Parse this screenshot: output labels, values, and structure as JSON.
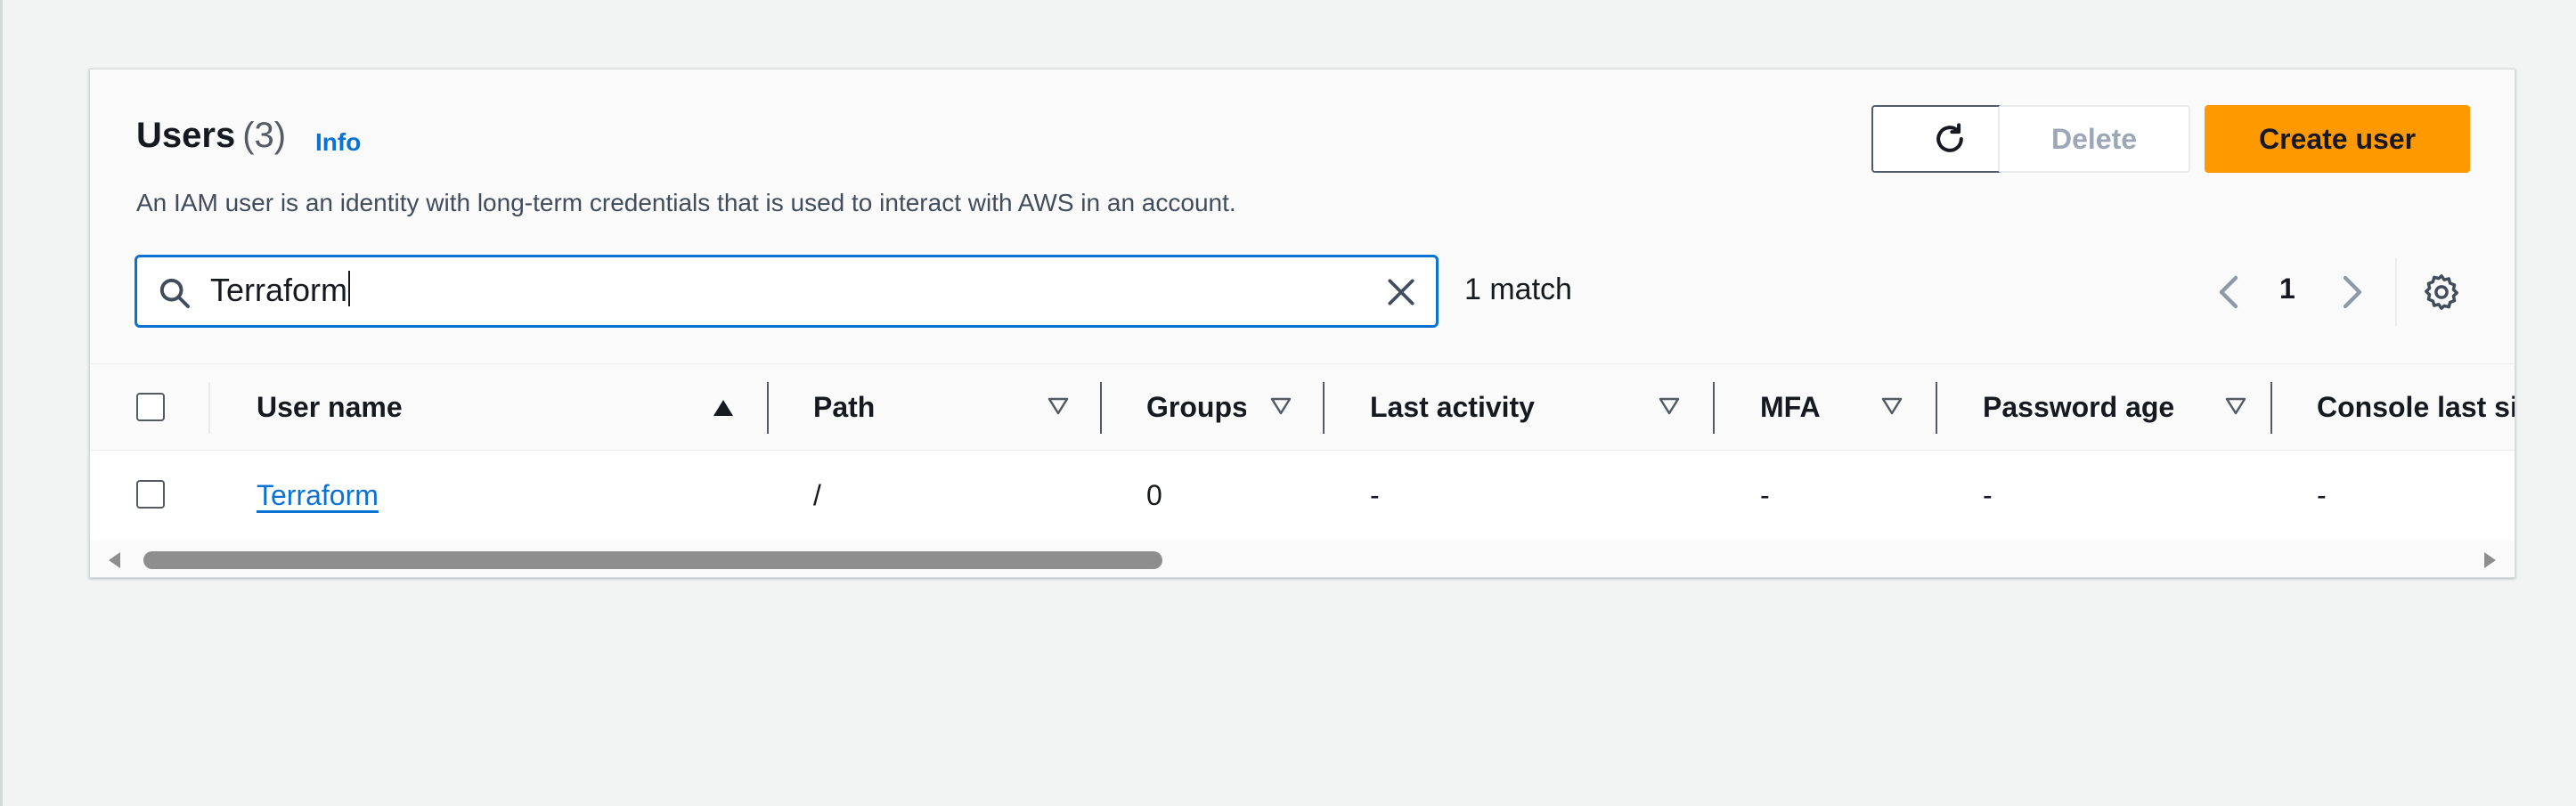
{
  "header": {
    "title": "Users",
    "count": "(3)",
    "info": "Info",
    "description": "An IAM user is an identity with long-term credentials that is used to interact with AWS in an account."
  },
  "actions": {
    "delete_label": "Delete",
    "create_label": "Create user"
  },
  "search": {
    "value": "Terraform",
    "match_text": "1 match"
  },
  "pagination": {
    "current_page": "1"
  },
  "table": {
    "columns": [
      "User name",
      "Path",
      "Groups",
      "Last activity",
      "MFA",
      "Password age",
      "Console last sign-in"
    ],
    "rows": [
      {
        "user_name": "Terraform",
        "path": "/",
        "groups": "0",
        "last_activity": "-",
        "mfa": "-",
        "password_age": "-",
        "console_last_signin": "-"
      }
    ]
  },
  "colors": {
    "accent": "#0972d3",
    "primary_button": "#ff9900",
    "disabled_text": "#9ba7b6"
  }
}
